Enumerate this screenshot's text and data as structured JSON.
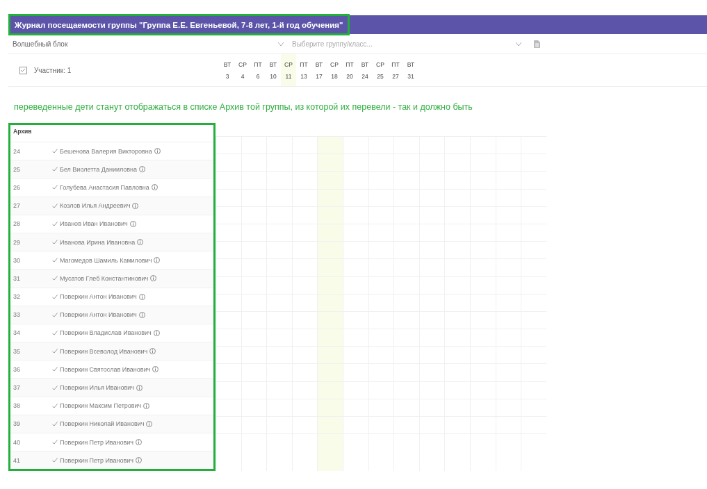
{
  "header": {
    "title": "Журнал посещаемости группы \"Группа Е.Е. Евгеньевой, 7-8 лет, 1-й год обучения\""
  },
  "filters": {
    "program_select": {
      "value": "Волшебный блок"
    },
    "group_select": {
      "placeholder": "Выберите группу/класс..."
    }
  },
  "participants": {
    "label": "Участник: 1"
  },
  "days": [
    {
      "weekday": "ВТ",
      "date": "3",
      "selected": false
    },
    {
      "weekday": "СР",
      "date": "4",
      "selected": false
    },
    {
      "weekday": "ПТ",
      "date": "6",
      "selected": false
    },
    {
      "weekday": "ВТ",
      "date": "10",
      "selected": false
    },
    {
      "weekday": "СР",
      "date": "11",
      "selected": true
    },
    {
      "weekday": "ПТ",
      "date": "13",
      "selected": false
    },
    {
      "weekday": "ВТ",
      "date": "17",
      "selected": false
    },
    {
      "weekday": "СР",
      "date": "18",
      "selected": false
    },
    {
      "weekday": "ПТ",
      "date": "20",
      "selected": false
    },
    {
      "weekday": "ВТ",
      "date": "24",
      "selected": false
    },
    {
      "weekday": "СР",
      "date": "25",
      "selected": false
    },
    {
      "weekday": "ПТ",
      "date": "27",
      "selected": false
    },
    {
      "weekday": "ВТ",
      "date": "31",
      "selected": false
    }
  ],
  "note": "переведенные дети станут отображаться в списке Архив той группы, из которой их перевели - так и должно быть",
  "archive": {
    "title": "Архив",
    "rows": [
      {
        "number": "24",
        "name": "Бешенова Валерия Викторовна"
      },
      {
        "number": "25",
        "name": "Бел Виолетта Данииловна"
      },
      {
        "number": "26",
        "name": "Голубева Анастасия Павловна"
      },
      {
        "number": "27",
        "name": "Козлов Илья Андреевич"
      },
      {
        "number": "28",
        "name": "Иванов Иван Иванович"
      },
      {
        "number": "29",
        "name": "Иванова Ирина Ивановна"
      },
      {
        "number": "30",
        "name": "Магомедов Шамиль Камилович"
      },
      {
        "number": "31",
        "name": "Мусатов Глеб Константинович"
      },
      {
        "number": "32",
        "name": "Поверкин Антон Иванович"
      },
      {
        "number": "33",
        "name": "Поверкин Антон Иванович"
      },
      {
        "number": "34",
        "name": "Поверкин Владислав Иванович"
      },
      {
        "number": "35",
        "name": "Поверкин Всеволод Иванович"
      },
      {
        "number": "36",
        "name": "Поверкин Святослав Иванович"
      },
      {
        "number": "37",
        "name": "Поверкин Илья Иванович"
      },
      {
        "number": "38",
        "name": "Поверкин Максим Петрович"
      },
      {
        "number": "39",
        "name": "Поверкин Николай Иванович"
      },
      {
        "number": "40",
        "name": "Поверкин Петр Иванович"
      },
      {
        "number": "41",
        "name": "Поверкин Петр Иванович"
      }
    ]
  }
}
